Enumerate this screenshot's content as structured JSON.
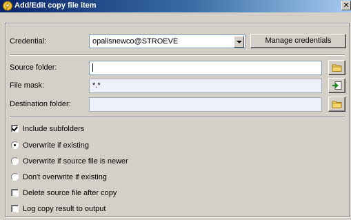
{
  "window": {
    "title": "Add/Edit copy file item",
    "close_glyph": "✕"
  },
  "credential": {
    "label": "Credential:",
    "selected": "opalisnewco@STROEVE",
    "manage_button": "Manage credentials"
  },
  "source_folder": {
    "label": "Source folder:",
    "value": ""
  },
  "file_mask": {
    "label": "File mask:",
    "value": "*.*"
  },
  "destination_folder": {
    "label": "Destination folder:",
    "value": ""
  },
  "options": {
    "include_subfolders": {
      "label": "Include subfolders",
      "checked": true
    },
    "overwrite_mode": {
      "selected_index": 0,
      "choices": [
        "Overwrite if existing",
        "Overwrite if source file is newer",
        "Don't overwrite if existing"
      ]
    },
    "delete_source": {
      "label": "Delete source file after copy",
      "checked": false
    },
    "log_result": {
      "label": "Log copy result to output",
      "checked": false
    }
  },
  "icons": {
    "app": "opalis-bolt-icon",
    "source_browse": "folder-icon",
    "file_mask_action": "insert-arrow-icon",
    "destination_browse": "folder-icon"
  },
  "colors": {
    "title_bar_start": "#0a246a",
    "title_bar_end": "#a6caf0",
    "dialog_bg": "#d4d0c8",
    "folder_yellow": "#f6d66a"
  }
}
